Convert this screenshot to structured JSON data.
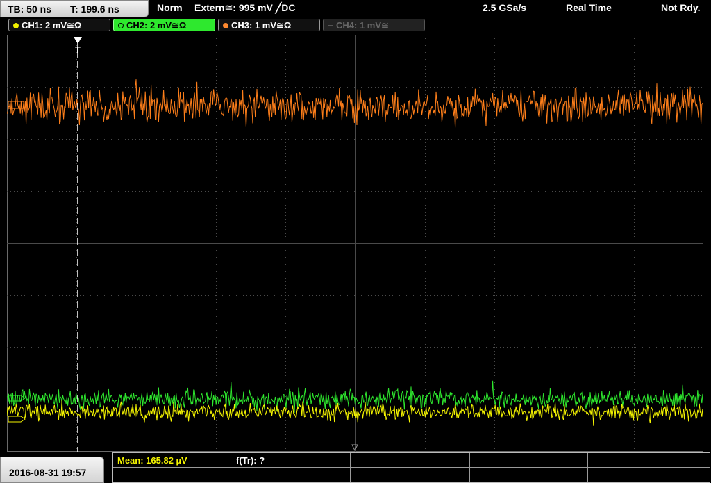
{
  "status_bar": {
    "timebase": "TB: 50 ns",
    "trigger_time": "T: 199.6 ns",
    "mode": "Norm",
    "trigger_source": "Extern≅: 995 mV ╱DC",
    "sample_rate": "2.5 GSa/s",
    "acquisition": "Real Time",
    "state": "Not Rdy."
  },
  "channels": [
    {
      "label": "CH1: 2 mV≅Ω",
      "color": "#f2f200",
      "active": true
    },
    {
      "label": "CH2: 2 mV≅Ω",
      "color": "#22dd22",
      "active": true,
      "selected": true
    },
    {
      "label": "CH3: 1 mV≅Ω",
      "color": "#ff8a30",
      "active": true
    },
    {
      "label": "CH4: 1 mV≅",
      "color": "#666666",
      "active": false
    }
  ],
  "trigger_marker": "T",
  "footer": {
    "datetime": "2016-08-31 19:57",
    "mean_label": "Mean: 165.82 µV",
    "ftr_label": "f(Tr): ?"
  },
  "colors": {
    "ch1": "#f5f500",
    "ch2": "#2ee82e",
    "ch3": "#ff7f1a",
    "grid": "#4a4a4a",
    "background": "#000000"
  }
}
